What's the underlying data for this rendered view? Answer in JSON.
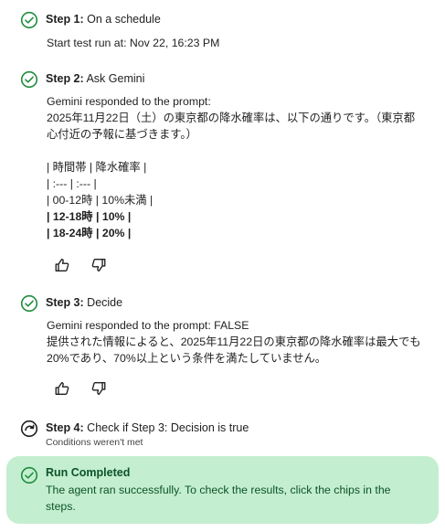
{
  "steps": [
    {
      "label": "Step 1:",
      "title": " On a schedule",
      "detail": "Start test run at: Nov 22, 16:23 PM"
    },
    {
      "label": "Step 2:",
      "title": " Ask Gemini",
      "lines": [
        "Gemini responded to the prompt:",
        "2025年11月22日（土）の東京都の降水確率は、以下の通りです。（東京都",
        "心付近の予報に基づきます。）",
        "",
        "| 時間帯 | 降水確率 |",
        "| :--- | :--- |",
        "| 00-12時 | 10%未満 |"
      ],
      "bold_lines": [
        "| 12-18時 | 10% |",
        "| 18-24時 | 20% |"
      ]
    },
    {
      "label": "Step 3:",
      "title": " Decide",
      "lines": [
        "Gemini responded to the prompt: FALSE",
        "提供された情報によると、2025年11月22日の東京都の降水確率は最大でも",
        "20%であり、70%以上という条件を満たしていません。"
      ]
    },
    {
      "label": "Step 4:",
      "title": " Check if Step 3: Decision is true",
      "detail": "Conditions weren't met"
    }
  ],
  "completed": {
    "title": "Run Completed",
    "message": "The agent ran successfully. To check the results, click the chips in the steps."
  },
  "icons": {
    "check": "check-circle-icon",
    "skipped": "skip-circle-icon",
    "like": "thumbs-up-icon",
    "dislike": "thumbs-down-icon"
  },
  "colors": {
    "check_green": "#1e8e3e",
    "completed_bg": "#c4eed0",
    "completed_text": "#0b5328"
  }
}
